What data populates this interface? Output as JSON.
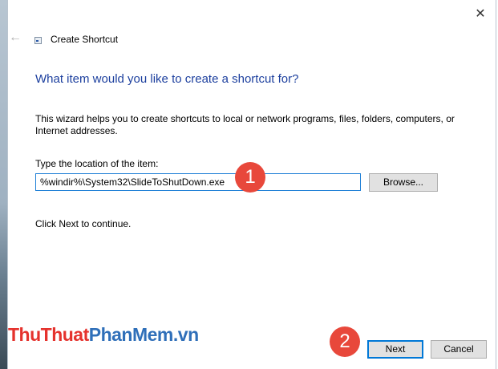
{
  "window": {
    "title": "Create Shortcut"
  },
  "icons": {
    "close": "close-icon",
    "back": "back-arrow-icon",
    "shortcut": "shortcut-icon"
  },
  "symbols": {
    "close": "✕",
    "back": "←"
  },
  "main": {
    "heading": "What item would you like to create a shortcut for?",
    "description": "This wizard helps you to create shortcuts to local or network programs, files, folders, computers, or Internet addresses.",
    "location_label": "Type the location of the item:",
    "location_value": "%windir%\\System32\\SlideToShutDown.exe",
    "browse_label": "Browse...",
    "instruction": "Click Next to continue."
  },
  "footer": {
    "next_label": "Next",
    "cancel_label": "Cancel"
  },
  "annotations": {
    "step1": "1",
    "step2": "2"
  },
  "watermark": {
    "part1": "ThuThuat",
    "part2": "PhanMem",
    "part3": ".vn"
  },
  "colors": {
    "heading": "#1c3f9e",
    "badge": "#e8483b",
    "focus": "#0078d7",
    "watermark_red": "#e5322d",
    "watermark_blue": "#2f6fb9"
  }
}
